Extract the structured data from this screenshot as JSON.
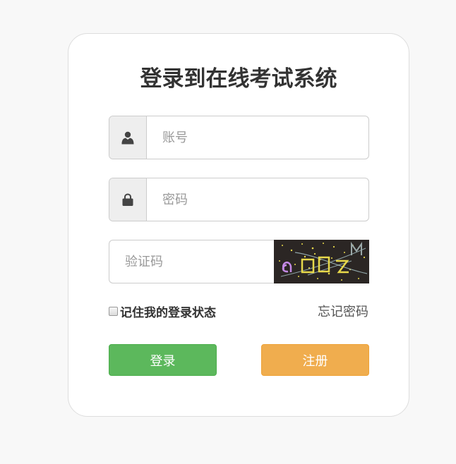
{
  "login_form": {
    "title": "登录到在线考试系统",
    "account": {
      "placeholder": "账号",
      "icon": "user-icon"
    },
    "password": {
      "placeholder": "密码",
      "icon": "lock-icon"
    },
    "captcha": {
      "placeholder": "验证码"
    },
    "remember_label": "记住我的登录状态",
    "forgot_label": "忘记密码",
    "login_label": "登录",
    "register_label": "注册"
  },
  "colors": {
    "login_button": "#5cb85c",
    "register_button": "#f0ad4e",
    "background": "#f8f8f8"
  }
}
